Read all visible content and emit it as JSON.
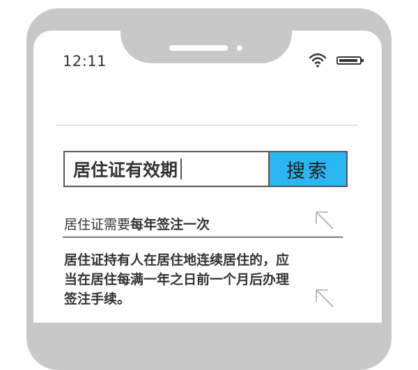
{
  "status_bar": {
    "time": "12:11"
  },
  "search": {
    "value": "居住证有效期",
    "button_label": "搜索"
  },
  "results": [
    {
      "title_prefix": "居住证需要",
      "title_highlight": "每年签注一次"
    }
  ],
  "answer": {
    "text": "居住证持有人在居住地连续居住的，应当在居住每满一年之日前一个月后办理签注手续。"
  },
  "colors": {
    "frame": "#c8c8c8",
    "search_button": "#2bb6f2",
    "text": "#333333"
  },
  "icons": {
    "status": [
      "wifi-icon",
      "battery-icon"
    ],
    "result": "arrow-up-left-icon"
  }
}
